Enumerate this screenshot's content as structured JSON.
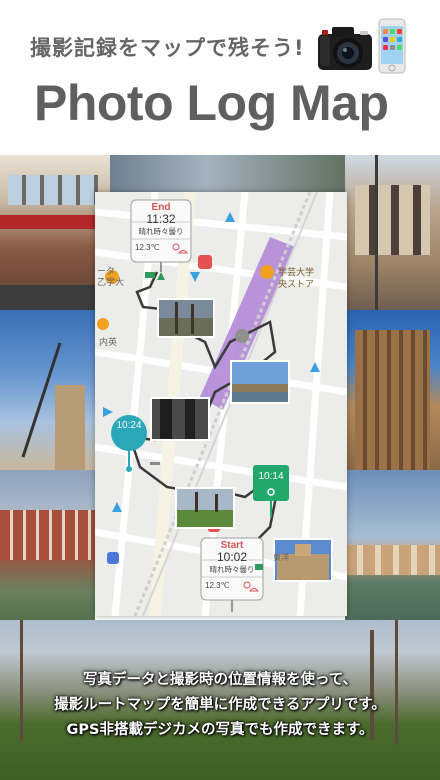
{
  "header": {
    "tagline": "撮影記録をマップで残そう!",
    "title": "Photo Log Map"
  },
  "map": {
    "end_marker": {
      "label": "End",
      "time": "11:32",
      "weather": "晴れ時々曇り",
      "temperature": "12.3℃"
    },
    "start_marker": {
      "label": "Start",
      "time": "10:02",
      "weather": "晴れ時々曇り",
      "temperature": "12.3℃"
    },
    "waypoint_1": {
      "time": "10:24"
    },
    "waypoint_2": {
      "time": "10:14"
    },
    "place_labels": [
      "ータ",
      "乙学大",
      "学芸大学",
      "央ストア",
      "内英",
      "東洋"
    ]
  },
  "caption": {
    "line1": "写真データと撮影時の位置情報を使って、",
    "line2": "撮影ルートマップを簡単に作成できるアプリです。",
    "line3": "GPS非搭載デジカメの写真でも作成できます。"
  },
  "colors": {
    "route_line": "#3a3a3a",
    "rail_band": "#b48ad8",
    "waypoint_teal": "#2aa7b8",
    "waypoint_green": "#22a86a",
    "end_red": "#d9534f",
    "start_red": "#d9534f"
  }
}
